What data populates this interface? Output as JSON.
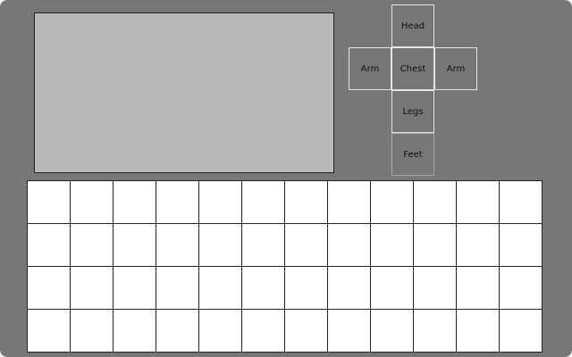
{
  "equipment": {
    "head": "Head",
    "arm_left": "Arm",
    "chest": "Chest",
    "arm_right": "Arm",
    "legs": "Legs",
    "feet": "Feet"
  },
  "inventory": {
    "columns": 12,
    "rows": 4
  },
  "colors": {
    "window": "#777777",
    "preview": "#b9b9b9",
    "cell": "#ffffff",
    "grid_line": "#222222",
    "slot_border": "#e6e6e6"
  }
}
